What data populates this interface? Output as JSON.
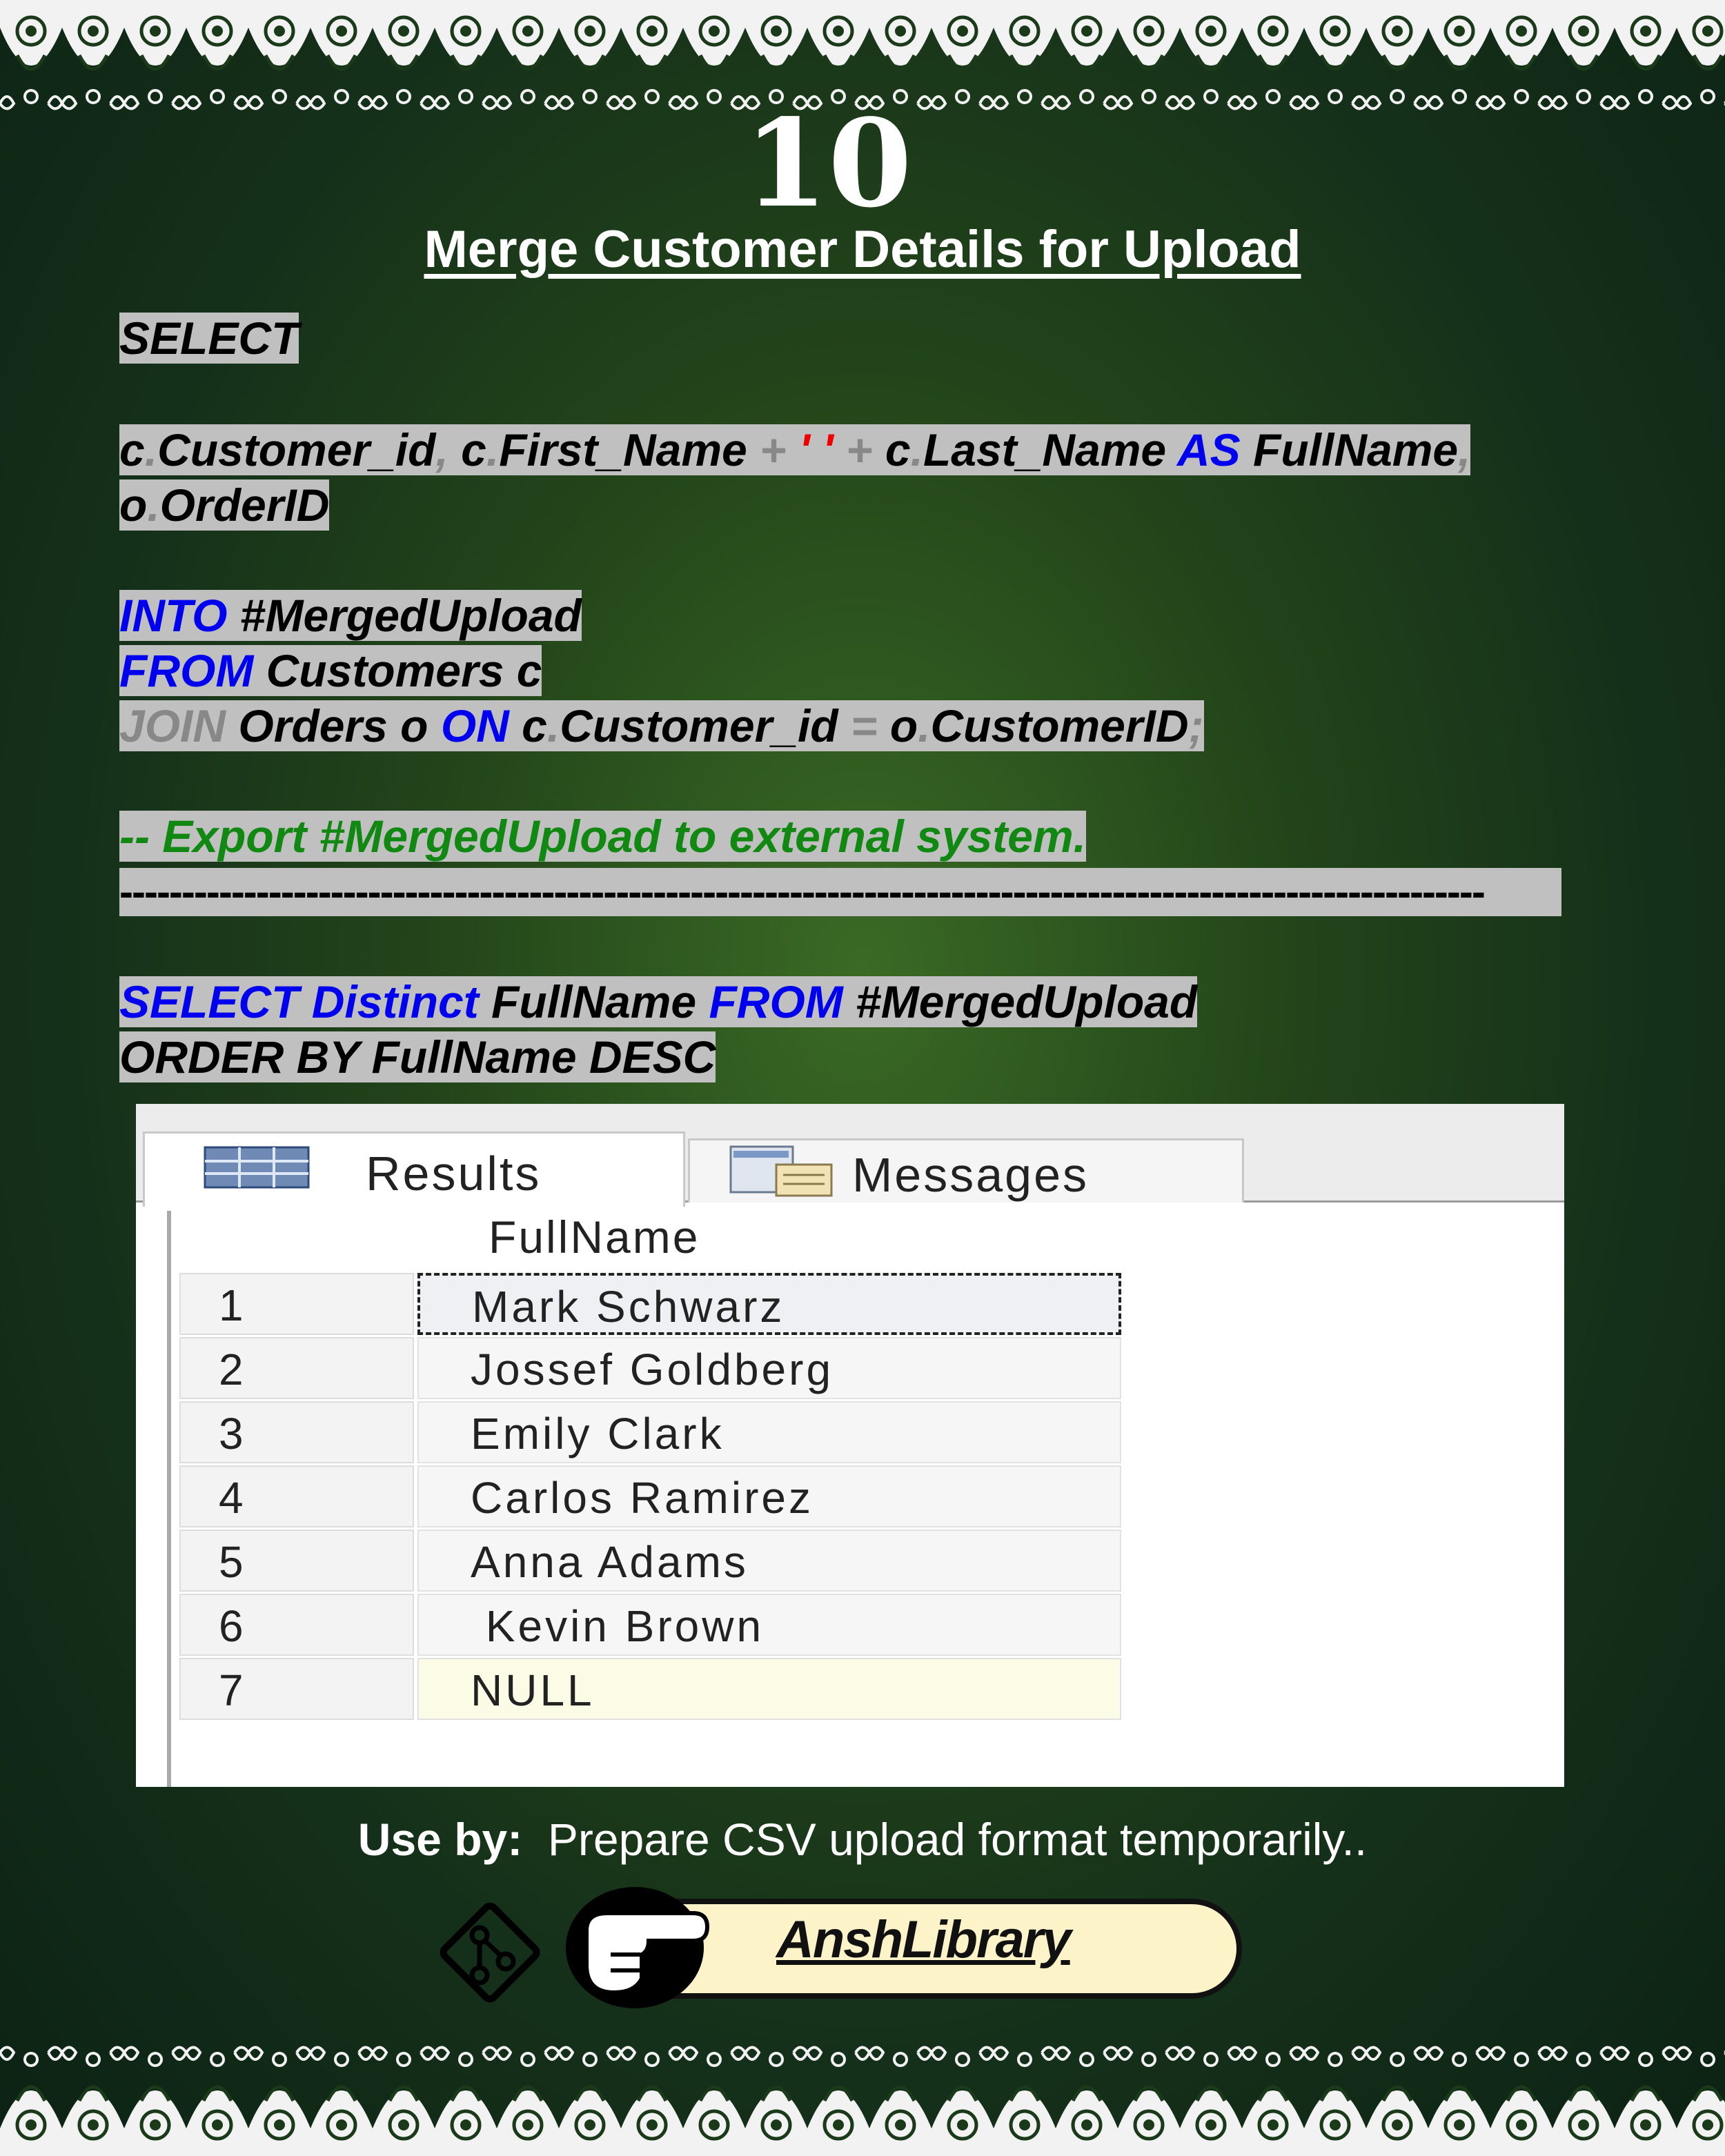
{
  "header": {
    "number": "10",
    "title": "Merge Customer Details for Upload"
  },
  "code": {
    "l1_select": "SELECT",
    "l2_a": "c",
    "l2_b": ".",
    "l2_c": "Customer_id",
    "l2_d": ",",
    "l2_e": " c",
    "l2_f": ".",
    "l2_g": "First_Name ",
    "l2_h": "+ ",
    "l2_i": "' '",
    "l2_j": " + ",
    "l2_k": "c",
    "l2_l": ".",
    "l2_m": "Last_Name ",
    "l2_as": "AS",
    "l2_n": " FullName",
    "l2_o": ",",
    "l3_a": "o",
    "l3_b": ".",
    "l3_c": "OrderID",
    "l4_into": "INTO",
    "l4_t": " #MergedUpload",
    "l5_from": "FROM",
    "l5_t": " Customers c",
    "l6_join": "JOIN",
    "l6_a": " Orders o ",
    "l6_on": "ON",
    "l6_b": " c",
    "l6_c": ".",
    "l6_d": "Customer_id ",
    "l6_e": "=",
    "l6_f": " o",
    "l6_g": ".",
    "l6_h": "CustomerID",
    "l6_i": ";",
    "comment": "-- Export #MergedUpload to external system.",
    "separator": "--------------------------------------------------------------------------------------------------------------",
    "l7_select": "SELECT",
    "l7_distinct": " Distinct",
    "l7_a": " FullName ",
    "l7_from": "FROM",
    "l7_b": " #MergedUpload",
    "l8": "ORDER BY FullName DESC"
  },
  "results": {
    "tab_results": "Results",
    "tab_messages": "Messages",
    "column": "FullName",
    "rows": [
      {
        "num": "1",
        "value": "Mark  Schwarz"
      },
      {
        "num": "2",
        "value": "Jossef Goldberg"
      },
      {
        "num": "3",
        "value": "Emily Clark"
      },
      {
        "num": "4",
        "value": "Carlos Ramirez"
      },
      {
        "num": "5",
        "value": "Anna Adams"
      },
      {
        "num": "6",
        "value": " Kevin Brown"
      },
      {
        "num": "7",
        "value": "NULL"
      }
    ]
  },
  "footer": {
    "useby_label": "Use by:",
    "useby_text": "  Prepare CSV upload format temporarily..",
    "brand": "AnshLibrary"
  },
  "colors": {
    "keyword": "#0000ee",
    "comment": "#118811",
    "code_highlight": "#c0c0c0",
    "badge": "#fdf3c8"
  }
}
